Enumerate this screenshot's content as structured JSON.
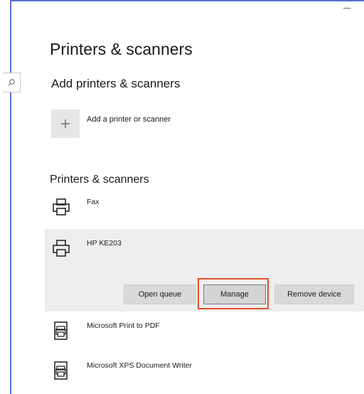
{
  "window": {
    "minimize_icon": "minimize-icon",
    "search_icon": "search-icon"
  },
  "page": {
    "title": "Printers & scanners"
  },
  "add_section": {
    "heading": "Add printers & scanners",
    "add_button_icon": "plus-icon",
    "add_label": "Add a printer or scanner"
  },
  "list_section": {
    "heading": "Printers & scanners",
    "devices": [
      {
        "name": "Fax",
        "icon": "printer-icon"
      },
      {
        "name": "HP KE203",
        "icon": "printer-icon",
        "selected": true
      },
      {
        "name": "Microsoft Print to PDF",
        "icon": "document-printer-icon"
      },
      {
        "name": "Microsoft XPS Document Writer",
        "icon": "document-printer-icon"
      }
    ],
    "actions": {
      "open_queue": "Open queue",
      "manage": "Manage",
      "remove_device": "Remove device"
    }
  },
  "colors": {
    "frame": "#5a6fd6",
    "highlight": "#e0502a",
    "selected_row": "#eeeeee"
  }
}
